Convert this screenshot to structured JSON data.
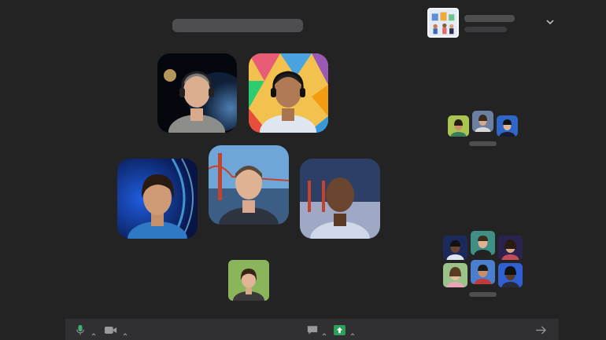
{
  "colors": {
    "background": "#232323",
    "toolbar": "#303032",
    "placeholder": "#4e4e50",
    "mic_green": "#3cb371",
    "share_green": "#2e9e5b",
    "icon_gray": "#9a9a9e"
  },
  "header": {
    "title_icon": "text-placeholder"
  },
  "room": {
    "thumbnail_icon": "room-illustration-icon",
    "expand_icon": "chevron-down-icon"
  },
  "stage": {
    "participants": [
      {
        "background": "space-earth",
        "headset": true
      },
      {
        "background": "colorful-polygons",
        "headset": true
      },
      {
        "background": "blue-swirl",
        "headset": false
      },
      {
        "background": "golden-gate-bridge",
        "headset": false
      },
      {
        "background": "golden-gate-fog",
        "headset": false
      },
      {
        "background": "green-outdoor",
        "headset": false
      }
    ]
  },
  "side_groups": [
    {
      "participant_count": 3
    },
    {
      "participant_count": 6
    }
  ],
  "toolbar": {
    "mic_icon": "microphone-icon",
    "video_icon": "video-camera-icon",
    "chat_icon": "chat-bubble-icon",
    "share_icon": "share-screen-icon",
    "leave_icon": "arrow-right-icon"
  }
}
